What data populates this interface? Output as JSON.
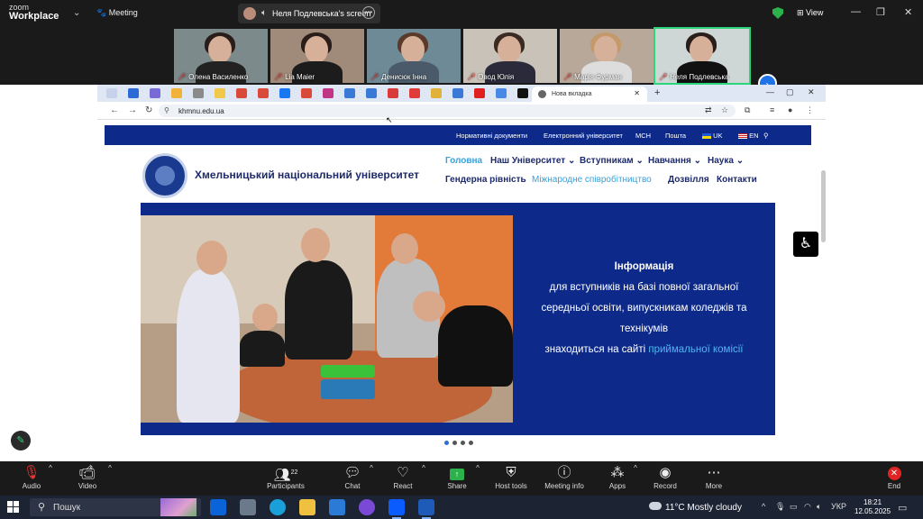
{
  "zoom": {
    "logo_top": "zoom",
    "logo_bottom": "Workplace",
    "meeting_label": "Meeting",
    "screen_label": "Неля Подлевська's screen",
    "view_label": "View",
    "participants": [
      {
        "name": "Олена Василенко"
      },
      {
        "name": "Lia Maier"
      },
      {
        "name": "Денисюк Інна"
      },
      {
        "name": "Овод Юлія"
      },
      {
        "name": "Марія Фурман"
      },
      {
        "name": "Неля Подлевська"
      }
    ],
    "toolbar": {
      "audio": "Audio",
      "video": "Video",
      "participants": "Participants",
      "participants_count": "22",
      "chat": "Chat",
      "react": "React",
      "share": "Share",
      "host_tools": "Host tools",
      "meeting_info": "Meeting info",
      "apps": "Apps",
      "record": "Record",
      "more": "More",
      "end": "End"
    }
  },
  "browser": {
    "active_tab_title": "Нова вкладка",
    "url": "khmnu.edu.ua"
  },
  "site": {
    "top_nav": [
      "Нормативні документи",
      "Електронний університет",
      "МСН",
      "Пошта",
      "UK",
      "EN"
    ],
    "university_name": "Хмельницький національний університет",
    "menu_row1": [
      "Головна",
      "Наш Університет",
      "Вступникам",
      "Навчання",
      "Наука"
    ],
    "menu_row2": [
      "Гендерна рівність",
      "Міжнародне співробітництво",
      "Дозвілля",
      "Контакти"
    ],
    "banner": {
      "line1": "Інформація",
      "line2": "для вступників на базі повної загальної",
      "line3": "середньої освіти, випускникам коледжів та",
      "line4": "технікумів",
      "line5_prefix": "знаходиться на сайті",
      "line5_link": "приймальної комісії"
    }
  },
  "taskbar": {
    "search_placeholder": "Пошук",
    "weather_temp": "11°C",
    "weather_text": "Mostly cloudy",
    "language": "УКР",
    "time": "18:21",
    "date": "12.05.2025"
  },
  "colors": {
    "site_blue": "#0d2a8a",
    "link_blue": "#4fb6f0",
    "zoom_green": "#2bd67b",
    "end_red": "#e02424"
  }
}
